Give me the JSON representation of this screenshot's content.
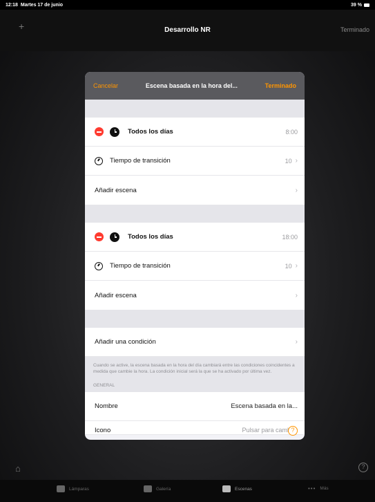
{
  "status_bar": {
    "time": "12:18",
    "date": "Martes 17 de junio",
    "battery": "39 %"
  },
  "nav": {
    "add_label": "+",
    "title": "Desarrollo NR",
    "done_label": "Terminado"
  },
  "modal": {
    "cancel_label": "Cancelar",
    "title": "Escena basada en la hora del...",
    "done_label": "Terminado",
    "schedules": [
      {
        "day_label": "Todos los días",
        "time": "8:00",
        "transition_label": "Tiempo de transición",
        "transition_value": "10",
        "add_scene_label": "Añadir escena"
      },
      {
        "day_label": "Todos los días",
        "time": "18:00",
        "transition_label": "Tiempo de transición",
        "transition_value": "10",
        "add_scene_label": "Añadir escena"
      }
    ],
    "add_condition_label": "Añadir una condición",
    "footnote": "Cuando se active, la escena basada en la hora del día cambiará entre las condiciones coincidentes a medida que cambie la hora. La condición inicial será la que se ha activado por última vez.",
    "general_header": "GENERAL",
    "name_label": "Nombre",
    "name_value": "Escena basada en la...",
    "icon_label": "Icono",
    "icon_value": "Pulsar para cambiar"
  },
  "tabbar": {
    "tabs": [
      {
        "label": "Lámparas",
        "icon": "lamp-icon"
      },
      {
        "label": "Galería",
        "icon": "gallery-icon"
      },
      {
        "label": "Escenas",
        "icon": "scenes-icon",
        "active": true
      },
      {
        "label": "Más",
        "icon": "more-icon"
      }
    ]
  },
  "colors": {
    "accent": "#ff9500",
    "destructive": "#ff3b30",
    "modal_header": "#5a5a5e",
    "grouped_bg": "#e5e5ea"
  }
}
